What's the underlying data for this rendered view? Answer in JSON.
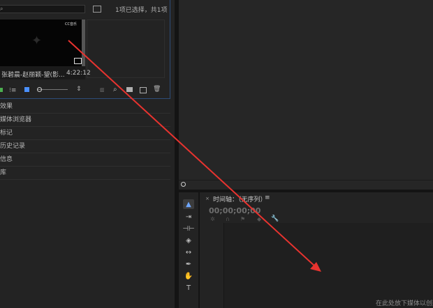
{
  "project": {
    "search_placeholder": "",
    "bin_icon": "bin-icon",
    "selection_info": "1项已选择，共1项",
    "clip": {
      "name": "张碧晨-赵丽颖-望(影...",
      "duration": "4:22:12",
      "badge": "CC音乐"
    },
    "toolbar": {
      "list_view": "list-view-icon",
      "icon_view": "icon-view-icon",
      "freeform": "freeform-view-icon",
      "zoom_slider": "zoom-slider",
      "sort": "sort-icon",
      "automate": "automate-icon",
      "find": "find-icon",
      "new_bin": "new-bin-icon",
      "new_item": "new-item-icon",
      "clear": "trash-icon"
    }
  },
  "panels": [
    {
      "label": "效果"
    },
    {
      "label": "媒体浏览器"
    },
    {
      "label": "标记"
    },
    {
      "label": "历史记录"
    },
    {
      "label": "信息"
    },
    {
      "label": "库"
    }
  ],
  "timeline": {
    "title": "时间轴：（无序列）",
    "menu_icon": "≡",
    "timecode": "00;00;00;00",
    "hint": "在此处放下媒体以创建"
  },
  "tools": [
    {
      "name": "selection-tool",
      "glyph": "▲"
    },
    {
      "name": "track-select-tool",
      "glyph": "⇥"
    },
    {
      "name": "ripple-edit-tool",
      "glyph": "⊣⊢"
    },
    {
      "name": "razor-tool",
      "glyph": "◈"
    },
    {
      "name": "slip-tool",
      "glyph": "↔"
    },
    {
      "name": "pen-tool",
      "glyph": "✒"
    },
    {
      "name": "hand-tool",
      "glyph": "✋"
    },
    {
      "name": "type-tool",
      "glyph": "T"
    }
  ],
  "colors": {
    "annotation_arrow": "#e8332f",
    "selection_blue": "#2d4c78",
    "accent_blue": "#4a90ff"
  }
}
